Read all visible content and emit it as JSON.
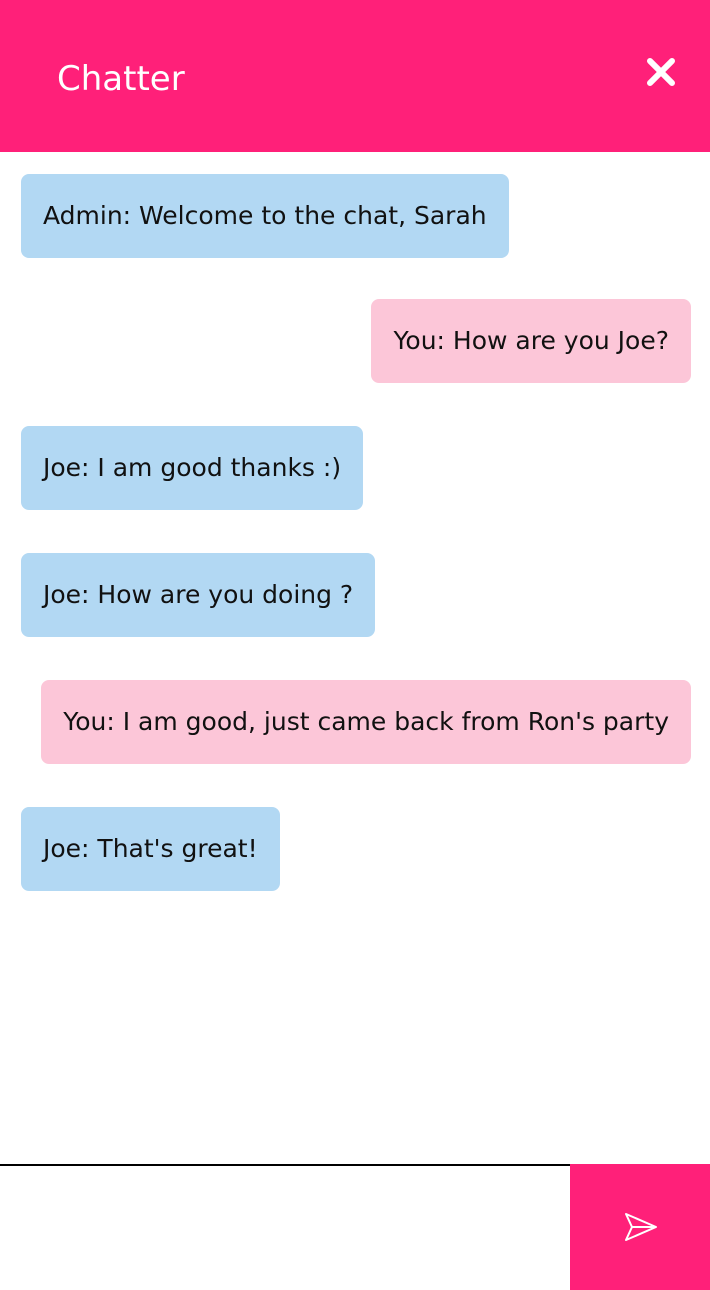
{
  "app": {
    "title": "Chatter",
    "accent_color": "#ff2079",
    "incoming_bubble_color": "#b2d8f3",
    "outgoing_bubble_color": "#fcc6d8"
  },
  "header": {
    "title": "Chatter",
    "close_icon": "close-icon"
  },
  "messages": [
    {
      "direction": "in",
      "text": "Admin: Welcome to the chat, Sarah"
    },
    {
      "direction": "out",
      "text": "You: How are you Joe?"
    },
    {
      "direction": "in",
      "text": "Joe: I am good thanks :)"
    },
    {
      "direction": "in",
      "text": "Joe: How are you doing ?"
    },
    {
      "direction": "out",
      "text": "You: I am good, just came back from Ron's party"
    },
    {
      "direction": "in",
      "text": "Joe: That's great!"
    }
  ],
  "composer": {
    "value": "",
    "placeholder": "",
    "send_icon": "send-icon"
  }
}
